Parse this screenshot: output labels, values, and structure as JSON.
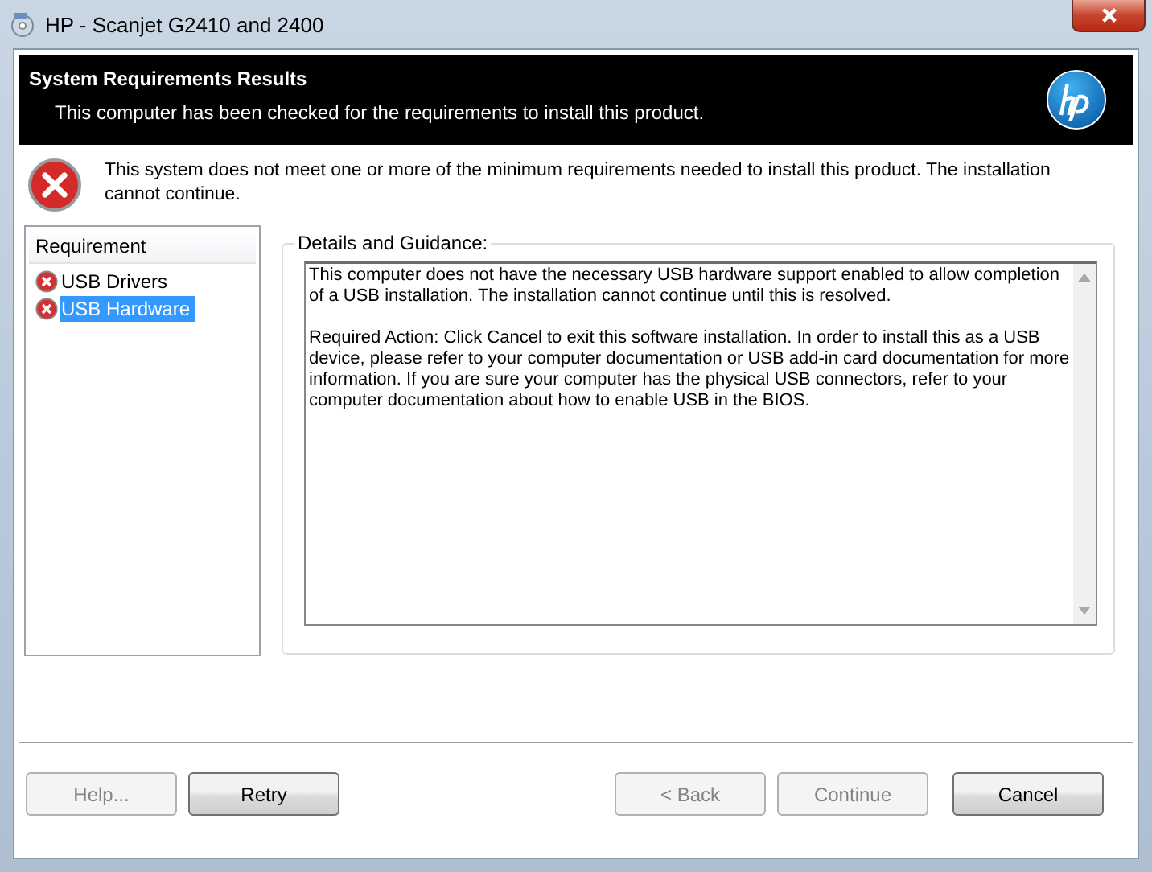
{
  "window": {
    "title": "HP - Scanjet G2410 and 2400"
  },
  "header": {
    "title": "System Requirements Results",
    "subtitle": "This computer has been checked for the requirements to install this product."
  },
  "error": {
    "message": "This system does not meet one or more of the minimum requirements needed to install this product.  The installation cannot continue."
  },
  "requirements": {
    "column": "Requirement",
    "items": [
      {
        "label": "USB Drivers",
        "selected": false
      },
      {
        "label": "USB Hardware",
        "selected": true
      }
    ]
  },
  "details": {
    "label": "Details and Guidance:",
    "paragraphs": [
      "This computer does not have the necessary USB hardware support enabled to allow completion of a USB installation. The installation cannot continue until this is resolved.",
      "Required Action: Click Cancel to exit this software installation. In order to install this as a USB device, please refer to your computer documentation or USB add-in card documentation for more information. If you are sure your computer has the physical USB connectors, refer to your computer documentation about how to enable USB in the BIOS."
    ]
  },
  "buttons": [
    {
      "label": "Help...",
      "disabled": true
    },
    {
      "label": "Retry",
      "disabled": false
    },
    {
      "label": "< Back",
      "disabled": true
    },
    {
      "label": "Continue",
      "disabled": true
    },
    {
      "label": "Cancel",
      "disabled": false
    }
  ]
}
